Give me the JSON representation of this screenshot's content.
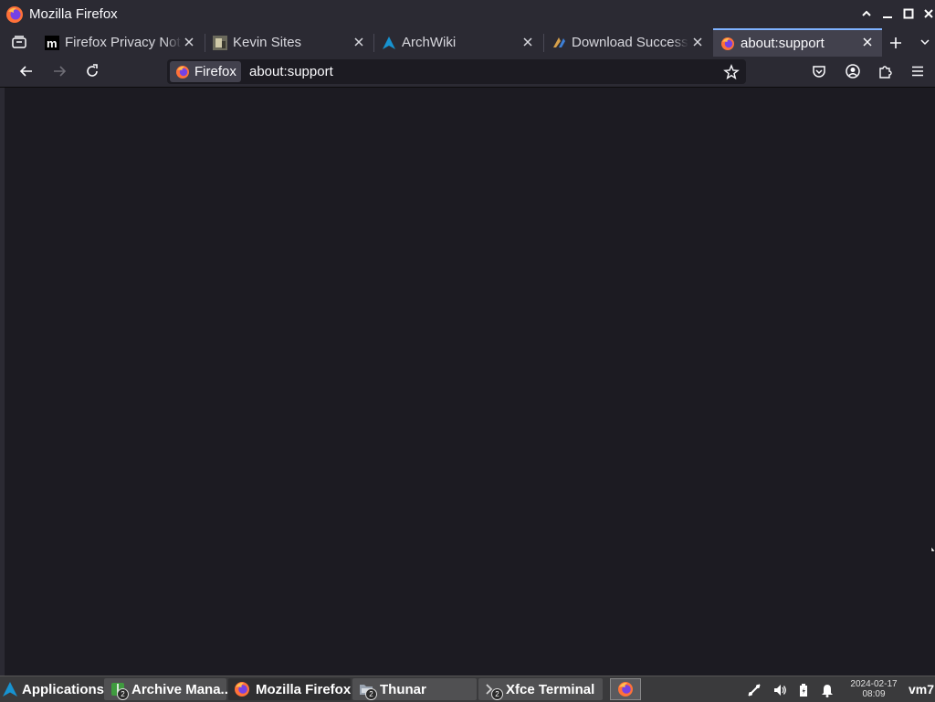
{
  "window": {
    "title": "Mozilla Firefox"
  },
  "tabs": [
    {
      "label": "Firefox Privacy Notice",
      "favicon": "mozilla-m-icon",
      "active": false
    },
    {
      "label": "Kevin Sites",
      "favicon": "site-thumbnail-icon",
      "active": false
    },
    {
      "label": "ArchWiki",
      "favicon": "arch-logo-icon",
      "active": false
    },
    {
      "label": "Download Successful",
      "favicon": "download-site-icon",
      "active": false
    },
    {
      "label": "about:support",
      "favicon": "firefox-icon",
      "active": true
    }
  ],
  "urlbar": {
    "identity_label": "Firefox",
    "url": "about:support"
  },
  "taskbar": {
    "menu_label": "Applications",
    "windows": [
      {
        "label": "Archive Mana...",
        "badge": "2",
        "active": false
      },
      {
        "label": "Mozilla Firefox",
        "badge": "",
        "active": true
      },
      {
        "label": "Thunar",
        "badge": "2",
        "active": false
      },
      {
        "label": "Xfce Terminal",
        "badge": "2",
        "active": false
      }
    ],
    "clock_date": "2024-02-17",
    "clock_time": "08:09",
    "host": "vm7"
  },
  "colors": {
    "accent": "#7fb2ff",
    "background": "#1c1b22",
    "toolbar": "#2b2a33"
  }
}
